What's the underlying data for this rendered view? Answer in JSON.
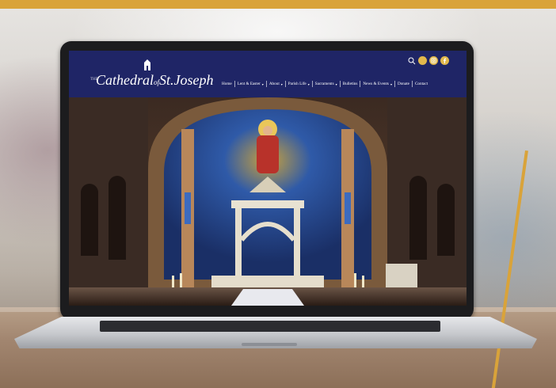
{
  "site": {
    "logo_the": "THE",
    "logo_main": "Cathedral",
    "logo_of": "of",
    "logo_end": "St.Joseph"
  },
  "nav": {
    "items": [
      {
        "label": "Home",
        "has_dropdown": false
      },
      {
        "label": "Lent & Easter",
        "has_dropdown": true
      },
      {
        "label": "About",
        "has_dropdown": true
      },
      {
        "label": "Parish Life",
        "has_dropdown": true
      },
      {
        "label": "Sacraments",
        "has_dropdown": true
      },
      {
        "label": "Bulletins",
        "has_dropdown": false
      },
      {
        "label": "News & Events",
        "has_dropdown": true
      },
      {
        "label": "Donate",
        "has_dropdown": false
      },
      {
        "label": "Contact",
        "has_dropdown": false
      }
    ]
  },
  "header_icons": [
    "search-icon",
    "social-icon",
    "instagram-icon",
    "facebook-icon"
  ],
  "colors": {
    "header_bg": "#1f2566",
    "icon_gold": "#e2b84c",
    "frame_gold": "#d9a33a"
  }
}
